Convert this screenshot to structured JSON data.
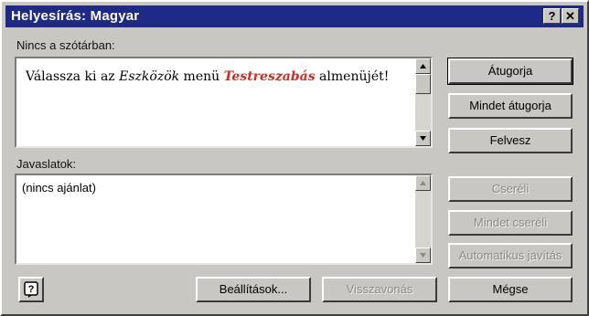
{
  "window": {
    "title": "Helyesírás: Magyar",
    "help_glyph": "?",
    "close_glyph": "✕"
  },
  "not_in_dictionary": {
    "label": "Nincs a szótárban:",
    "sentence": {
      "part1": "Válassza ki az ",
      "part2": "Eszközök",
      "part3": " menü ",
      "part4": "Testreszabás",
      "part5": " almenüjét!"
    }
  },
  "suggestions": {
    "label": "Javaslatok:",
    "items": [
      "(nincs ajánlat)"
    ]
  },
  "buttons": {
    "skip": "Átugorja",
    "skip_all": "Mindet átugorja",
    "add": "Felvesz",
    "replace": "Cseréli",
    "replace_all": "Mindet cseréli",
    "autocorrect": "Automatikus javítás",
    "options": "Beállítások...",
    "undo": "Visszavonás",
    "cancel": "Mégse",
    "assistant_glyph": "?"
  },
  "colors": {
    "titlebar": "#1e2a86",
    "dialog_bg": "#c9c7c2",
    "highlight_red": "#d42a1e"
  }
}
